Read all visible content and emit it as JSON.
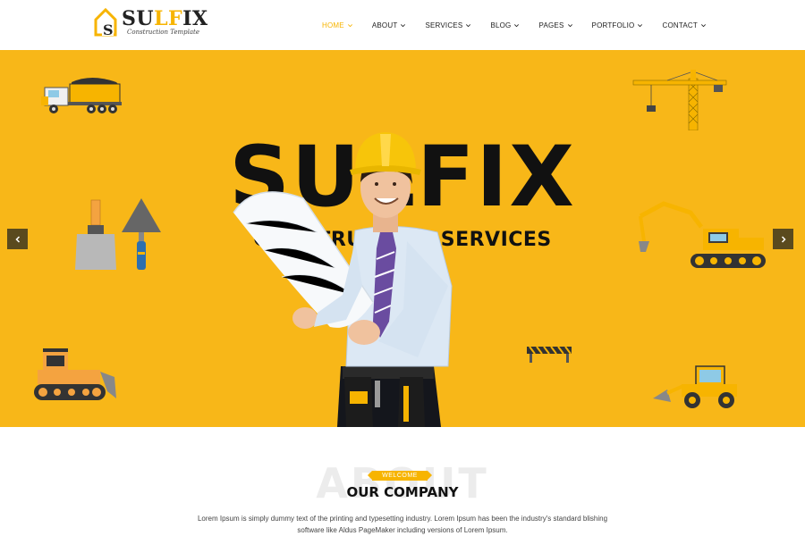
{
  "brand": {
    "name_part1": "SU",
    "name_part2": "LF",
    "name_part3": "IX",
    "tagline": "Construction Template",
    "accent": "#f7b400",
    "hero_bg": "#f8b718"
  },
  "nav": {
    "items": [
      {
        "label": "HOME",
        "active": true
      },
      {
        "label": "ABOUT",
        "active": false
      },
      {
        "label": "SERVICES",
        "active": false
      },
      {
        "label": "BLOG",
        "active": false
      },
      {
        "label": "PAGES",
        "active": false
      },
      {
        "label": "PORTFOLIO",
        "active": false
      },
      {
        "label": "CONTACT",
        "active": false
      }
    ]
  },
  "hero": {
    "title": "SULFIX",
    "subtitle": "CONSTRUCTION SERVICES",
    "prev_icon": "chevron-left-icon",
    "next_icon": "chevron-right-icon"
  },
  "about": {
    "bg_word": "ABOUT",
    "tag": "WELCOME",
    "title": "OUR COMPANY",
    "text": "Lorem Ipsum is simply dummy text of the printing and typesetting industry. Lorem Ipsum has been the industry's standard blishing software like Aldus PageMaker including versions of Lorem Ipsum."
  }
}
